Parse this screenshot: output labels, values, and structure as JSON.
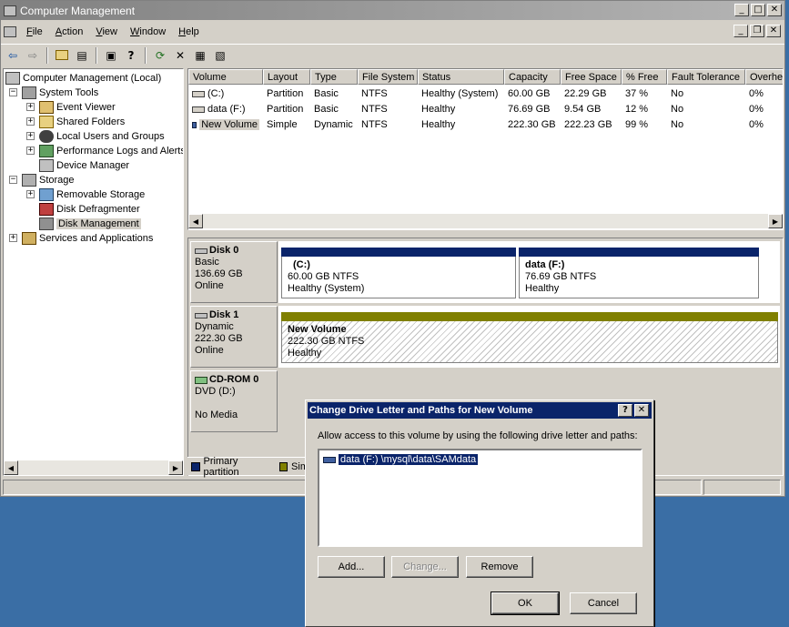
{
  "window": {
    "title": "Computer Management",
    "min": "_",
    "max": "□",
    "close": "✕",
    "mdi_min": "_",
    "mdi_restore": "❐",
    "mdi_close": "✕"
  },
  "menu": [
    {
      "label": "File",
      "u": "F",
      "rest": "ile"
    },
    {
      "label": "Action",
      "u": "A",
      "rest": "ction"
    },
    {
      "label": "View",
      "u": "V",
      "rest": "iew"
    },
    {
      "label": "Window",
      "u": "W",
      "rest": "indow"
    },
    {
      "label": "Help",
      "u": "H",
      "rest": "elp"
    }
  ],
  "toolbar": {
    "back": "⇦",
    "forward": "⇨",
    "up": "📁",
    "show_hide": "▤",
    "properties": "▣",
    "help": "?",
    "refresh": "⟳",
    "delete": "✕",
    "properties2": "▦",
    "export": "▧"
  },
  "tree": {
    "root": "Computer Management (Local)",
    "system_tools": "System Tools",
    "event_viewer": "Event Viewer",
    "shared_folders": "Shared Folders",
    "local_users": "Local Users and Groups",
    "perf_logs": "Performance Logs and Alerts",
    "device_manager": "Device Manager",
    "storage": "Storage",
    "removable": "Removable Storage",
    "defrag": "Disk Defragmenter",
    "disk_mgmt": "Disk Management",
    "services": "Services and Applications"
  },
  "volumes": {
    "headers": [
      "Volume",
      "Layout",
      "Type",
      "File System",
      "Status",
      "Capacity",
      "Free Space",
      "% Free",
      "Fault Tolerance",
      "Overhe"
    ],
    "rows": [
      [
        "(C:)",
        "Partition",
        "Basic",
        "NTFS",
        "Healthy (System)",
        "60.00 GB",
        "22.29 GB",
        "37 %",
        "No",
        "0%"
      ],
      [
        "data (F:)",
        "Partition",
        "Basic",
        "NTFS",
        "Healthy",
        "76.69 GB",
        "9.54 GB",
        "12 %",
        "No",
        "0%"
      ],
      [
        "New Volume",
        "Simple",
        "Dynamic",
        "NTFS",
        "Healthy",
        "222.30 GB",
        "222.23 GB",
        "99 %",
        "No",
        "0%"
      ]
    ]
  },
  "disks": {
    "disk0": {
      "name": "Disk 0",
      "type": "Basic",
      "size": "136.69 GB",
      "status": "Online"
    },
    "disk1": {
      "name": "Disk 1",
      "type": "Dynamic",
      "size": "222.30 GB",
      "status": "Online"
    },
    "cdrom": {
      "name": "CD-ROM 0",
      "type": "DVD (D:)",
      "status": "No Media"
    },
    "c": {
      "name": "(C:)",
      "size": "60.00 GB NTFS",
      "status": "Healthy (System)"
    },
    "f": {
      "name": "data  (F:)",
      "size": "76.69 GB NTFS",
      "status": "Healthy"
    },
    "nv": {
      "name": "New Volume",
      "size": "222.30 GB NTFS",
      "status": "Healthy"
    }
  },
  "legend": {
    "primary": "Primary partition",
    "simple": "Sim"
  },
  "colors": {
    "primary": "#0a246a",
    "simple": "#808000",
    "dialog_title": "#0a246a"
  },
  "dialog": {
    "title": "Change Drive Letter and Paths for New Volume",
    "help": "?",
    "close": "✕",
    "prompt": "Allow access to this volume by using the following drive letter and paths:",
    "path": "data (F:) \\mysql\\data\\SAMdata",
    "add": "Add...",
    "change": "Change...",
    "remove": "Remove",
    "ok": "OK",
    "cancel": "Cancel"
  }
}
